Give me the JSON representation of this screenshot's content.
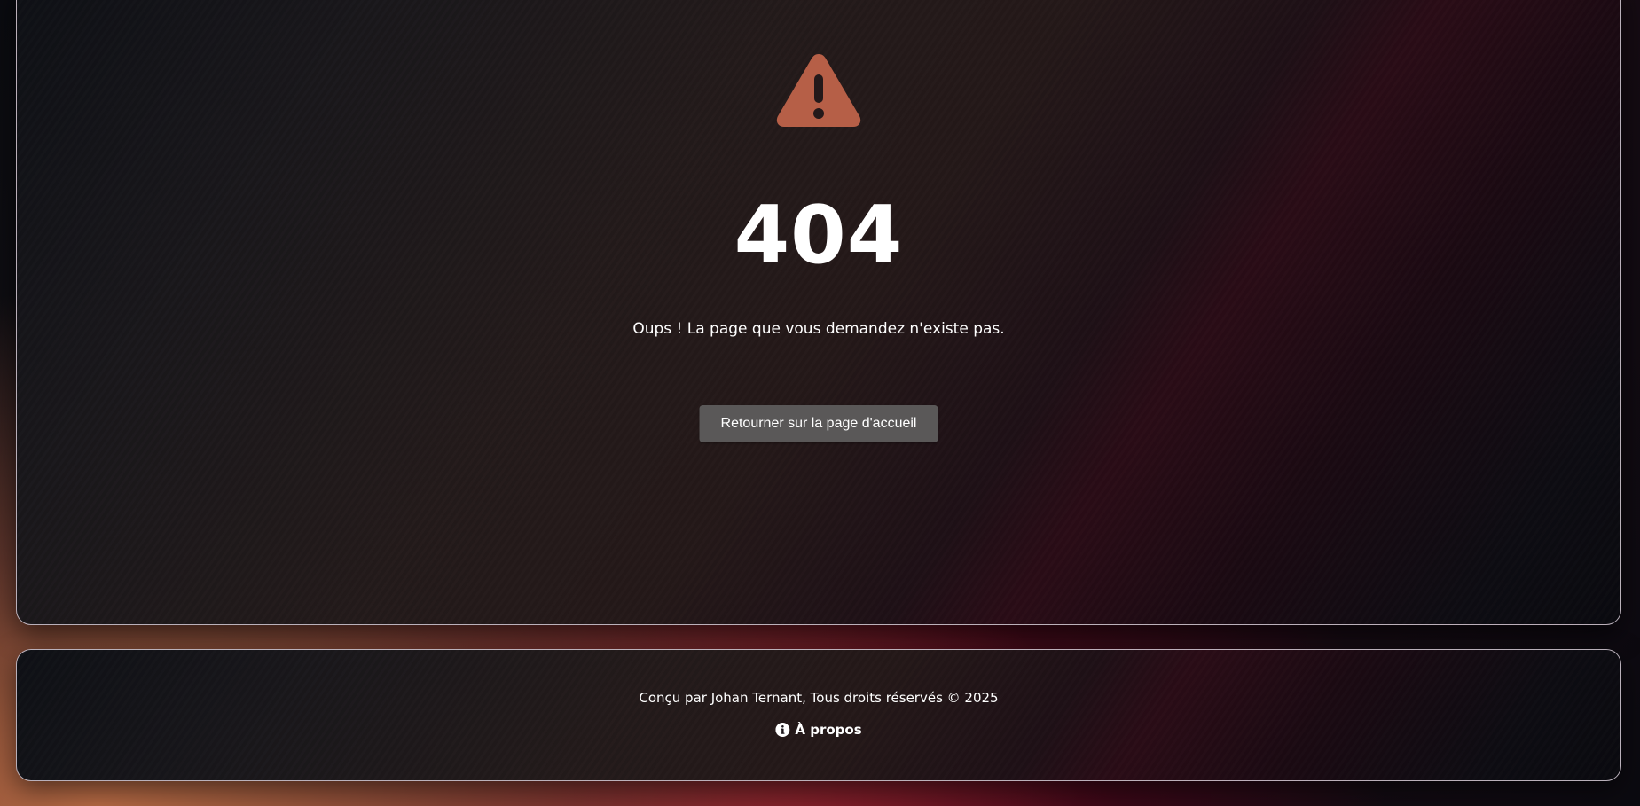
{
  "error": {
    "icon": "warning-triangle-icon",
    "icon_color": "#b65f47",
    "code": "404",
    "message": "Oups ! La page que vous demandez n'existe pas.",
    "home_button_label": "Retourner sur la page d'accueil"
  },
  "footer": {
    "credits": "Conçu par Johan Ternant, Tous droits réservés © 2025",
    "about_icon": "info-circle-icon",
    "about_label": "À propos"
  },
  "colors": {
    "button_background": "#5a5858",
    "panel_border": "#d7cdd7",
    "accent_orange": "#c06e46",
    "accent_crimson": "#a00a28"
  }
}
